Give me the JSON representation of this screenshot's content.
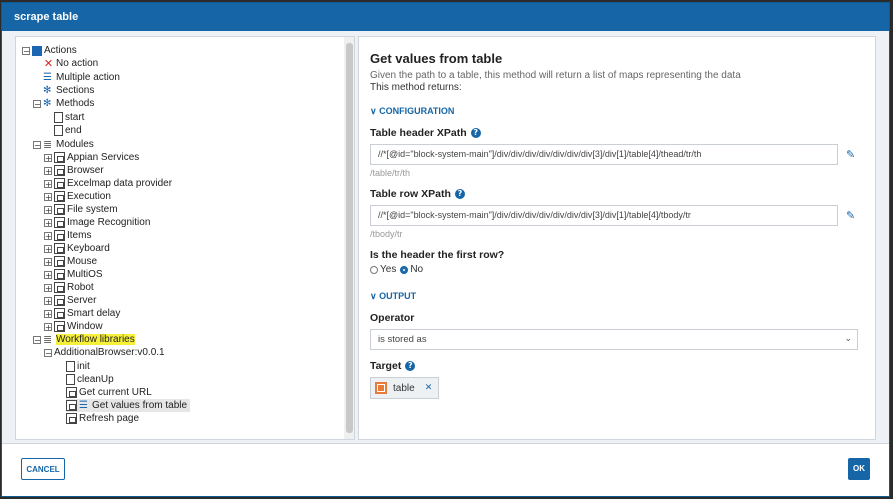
{
  "dialog": {
    "title": "scrape table"
  },
  "tree": {
    "actions": "Actions",
    "no_action": "No action",
    "multiple_action": "Multiple action",
    "sections": "Sections",
    "methods": "Methods",
    "start": "start",
    "end": "end",
    "modules": "Modules",
    "module_items": [
      "Appian Services",
      "Browser",
      "Excelmap data provider",
      "Execution",
      "File system",
      "Image Recognition",
      "Items",
      "Keyboard",
      "Mouse",
      "MultiOS",
      "Robot",
      "Server",
      "Smart delay",
      "Window"
    ],
    "workflow_libraries": "Workflow libraries",
    "additional_browser": "AdditionalBrowser:v0.0.1",
    "lib_items": [
      "init",
      "cleanUp",
      "Get current URL",
      "Get values from table",
      "Refresh page"
    ]
  },
  "detail": {
    "title": "Get values from table",
    "description": "Given the path to a table, this method will return a list of maps representing the data",
    "returns": "This method returns:",
    "config_section": "CONFIGURATION",
    "header_label": "Table header XPath",
    "header_value": "//*[@id=\"block-system-main\"]/div/div/div/div/div/div/div[3]/div[1]/table[4]/thead/tr/th",
    "header_sub": "/table/tr/th",
    "row_label": "Table row XPath",
    "row_value": "//*[@id=\"block-system-main\"]/div/div/div/div/div/div/div[3]/div[1]/table[4]/tbody/tr",
    "row_sub": "/tbody/tr",
    "first_row_label": "Is the header the first row?",
    "yes": "Yes",
    "no": "No",
    "first_row_selected": "No",
    "output_section": "OUTPUT",
    "operator_label": "Operator",
    "operator_value": "is stored as",
    "target_label": "Target",
    "target_chip": "table"
  },
  "footer": {
    "cancel": "CANCEL",
    "ok": "OK"
  },
  "colors": {
    "primary": "#1565a7",
    "highlight": "#f7f03a",
    "chip_icon": "#e97a3a",
    "error": "#d9261c"
  }
}
